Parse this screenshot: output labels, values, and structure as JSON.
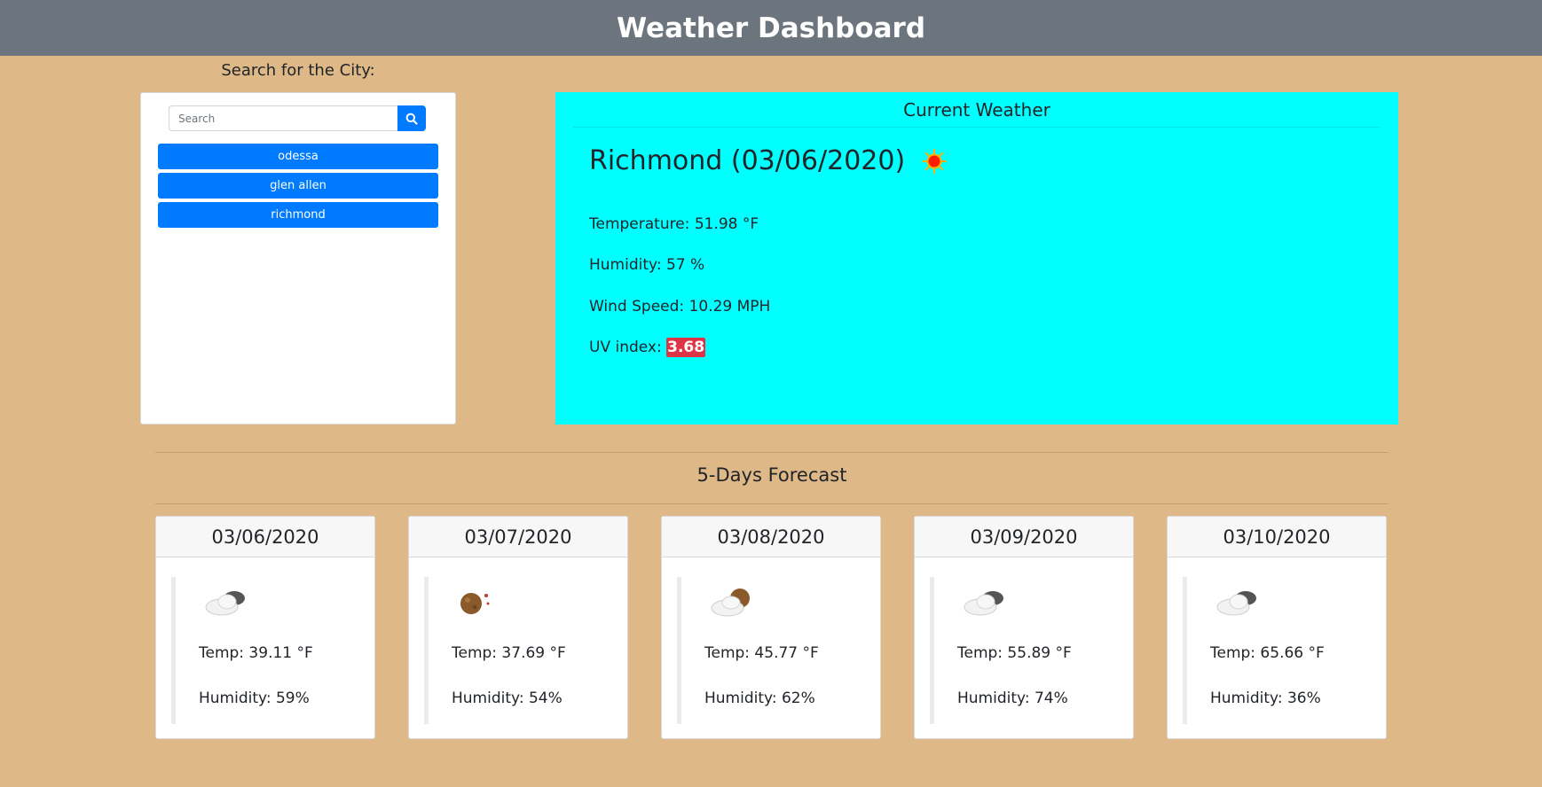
{
  "header": {
    "title": "Weather Dashboard"
  },
  "search": {
    "heading": "Search for the City:",
    "placeholder": "Search",
    "history": [
      "odessa",
      "glen allen",
      "richmond"
    ]
  },
  "current": {
    "section_title": "Current Weather",
    "heading": "Richmond (03/06/2020)",
    "icon": "sun-icon",
    "temperature": "Temperature: 51.98 °F",
    "humidity": "Humidity: 57 %",
    "wind": "Wind Speed: 10.29 MPH",
    "uv_label": "UV index: ",
    "uv_value": "3.68"
  },
  "forecast": {
    "title": "5-Days Forecast",
    "days": [
      {
        "date": "03/06/2020",
        "icon": "partly-cloudy-icon",
        "temp": "Temp: 39.11 °F",
        "humidity": "Humidity: 59%"
      },
      {
        "date": "03/07/2020",
        "icon": "clear-night-icon",
        "temp": "Temp: 37.69 °F",
        "humidity": "Humidity: 54%"
      },
      {
        "date": "03/08/2020",
        "icon": "cloudy-night-icon",
        "temp": "Temp: 45.77 °F",
        "humidity": "Humidity: 62%"
      },
      {
        "date": "03/09/2020",
        "icon": "partly-cloudy-icon",
        "temp": "Temp: 55.89 °F",
        "humidity": "Humidity: 74%"
      },
      {
        "date": "03/10/2020",
        "icon": "partly-cloudy-icon",
        "temp": "Temp: 65.66 °F",
        "humidity": "Humidity: 36%"
      }
    ]
  },
  "colors": {
    "background": "#deb887",
    "header": "#6c757d",
    "current_panel": "#00ffff",
    "button": "#007bff",
    "uv_badge": "#dc3545"
  }
}
